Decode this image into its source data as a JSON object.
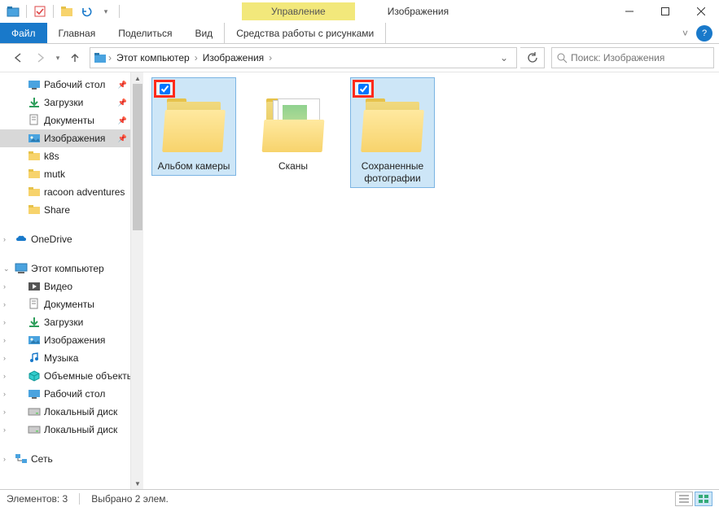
{
  "title": "Изображения",
  "ribbon_context": "Управление",
  "tabs": {
    "file": "Файл",
    "home": "Главная",
    "share": "Поделиться",
    "view": "Вид",
    "context": "Средства работы с рисунками"
  },
  "breadcrumb": {
    "root": "Этот компьютер",
    "current": "Изображения"
  },
  "search_placeholder": "Поиск: Изображения",
  "nav": {
    "quick": [
      {
        "label": "Рабочий стол",
        "icon": "desktop",
        "pinned": true
      },
      {
        "label": "Загрузки",
        "icon": "downloads",
        "pinned": true
      },
      {
        "label": "Документы",
        "icon": "documents",
        "pinned": true
      },
      {
        "label": "Изображения",
        "icon": "pictures",
        "pinned": true,
        "selected": true
      },
      {
        "label": "k8s",
        "icon": "folder"
      },
      {
        "label": "mutk",
        "icon": "folder"
      },
      {
        "label": "racoon adventures",
        "icon": "folder"
      },
      {
        "label": "Share",
        "icon": "folder"
      }
    ],
    "onedrive": "OneDrive",
    "thispc": "Этот компьютер",
    "thispc_items": [
      {
        "label": "Видео",
        "icon": "video"
      },
      {
        "label": "Документы",
        "icon": "documents"
      },
      {
        "label": "Загрузки",
        "icon": "downloads"
      },
      {
        "label": "Изображения",
        "icon": "pictures"
      },
      {
        "label": "Музыка",
        "icon": "music"
      },
      {
        "label": "Объемные объекты",
        "icon": "3d"
      },
      {
        "label": "Рабочий стол",
        "icon": "desktop"
      },
      {
        "label": "Локальный диск",
        "icon": "disk"
      },
      {
        "label": "Локальный диск",
        "icon": "disk"
      }
    ],
    "network": "Сеть"
  },
  "items": [
    {
      "label": "Альбом камеры",
      "selected": true,
      "highlight": true,
      "kind": "folder-plain"
    },
    {
      "label": "Сканы",
      "selected": false,
      "highlight": false,
      "kind": "folder-docs"
    },
    {
      "label": "Сохраненные фотографии",
      "selected": true,
      "highlight": true,
      "kind": "folder-plain"
    }
  ],
  "status": {
    "count": "Элементов: 3",
    "selected": "Выбрано 2 элем."
  }
}
